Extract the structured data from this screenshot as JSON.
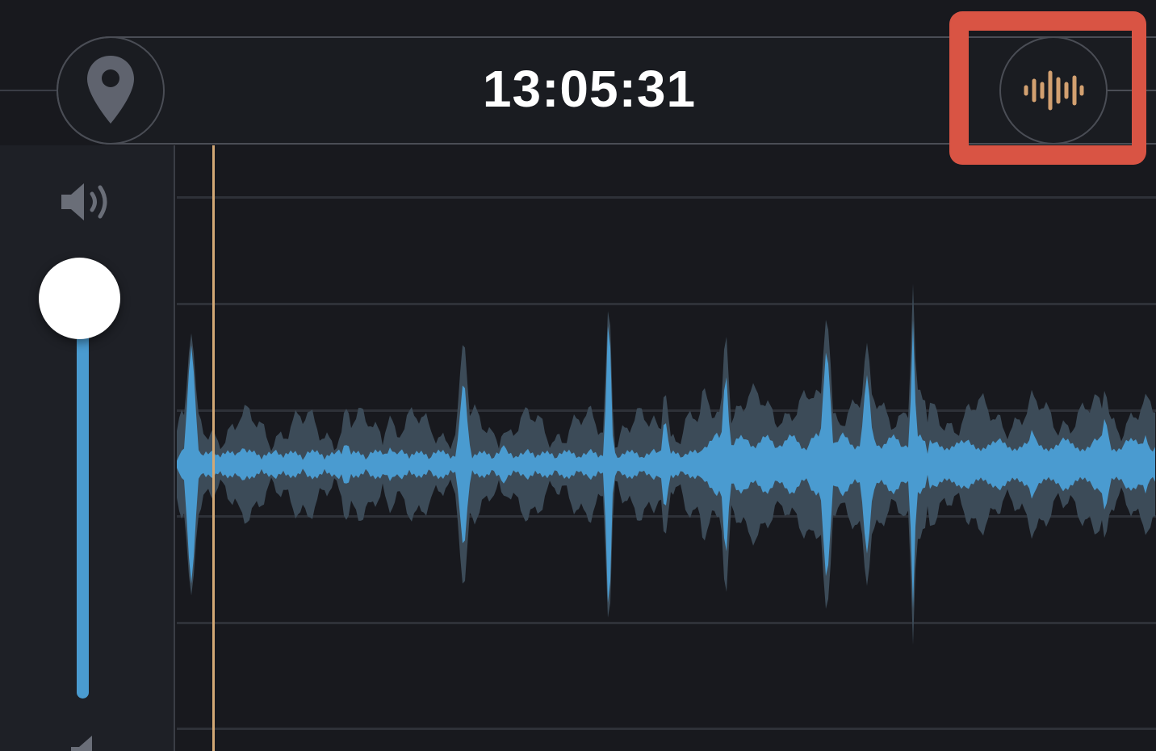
{
  "header": {
    "time": "13:05:31"
  },
  "icons": {
    "location": "location-pin-icon",
    "waveform": "waveform-icon",
    "volume_high": "speaker-high-icon",
    "volume_low": "speaker-low-icon"
  },
  "volume": {
    "level": 0.95
  },
  "colors": {
    "background": "#18191e",
    "panel": "#1e2026",
    "waveform_inner": "#4a9bd0",
    "waveform_outer": "#3c4b58",
    "playhead": "#d2a875",
    "waveform_icon": "#d2a070",
    "highlight": "#d95444",
    "slider": "#4a9bd0"
  }
}
